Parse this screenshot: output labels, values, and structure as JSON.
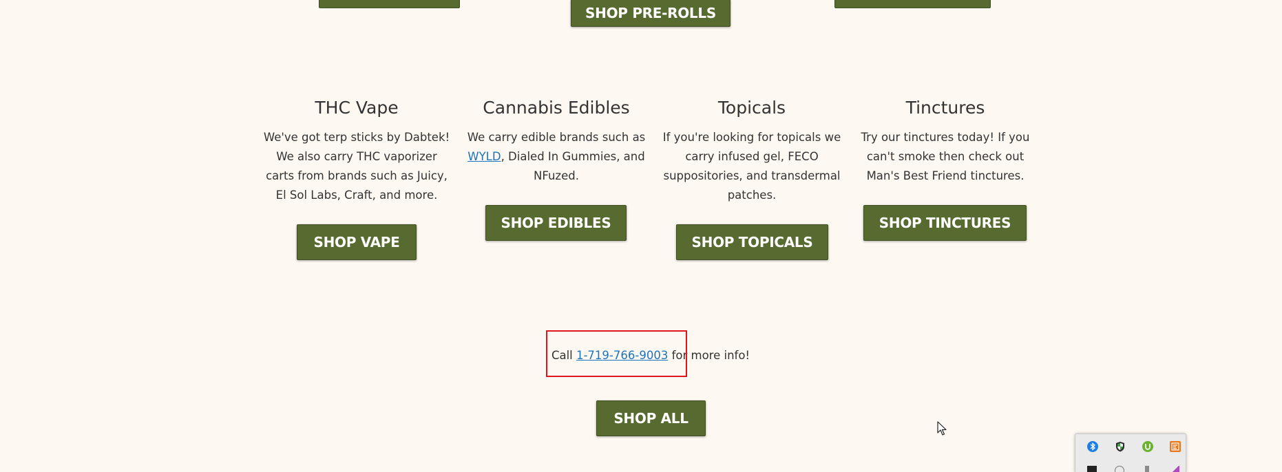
{
  "top_buttons": {
    "preroll_label": "SHOP PRE-ROLLS"
  },
  "categories": [
    {
      "title": "THC Vape",
      "text": "We've got terp sticks by Dabtek! We also carry THC vaporizer carts from brands such as Juicy, El Sol Labs, Craft, and more.",
      "button": "SHOP VAPE"
    },
    {
      "title": "Cannabis Edibles",
      "text_before": "We carry edible brands such as ",
      "link": "WYLD",
      "text_after": ", Dialed In Gummies, and NFuzed.",
      "button": "SHOP EDIBLES"
    },
    {
      "title": "Topicals",
      "text": "If you're looking for topicals we carry infused gel, FECO suppositories, and transdermal patches.",
      "button": "SHOP TOPICALS"
    },
    {
      "title": "Tinctures",
      "text": "Try our tinctures today! If you can't smoke then check out Man's Best Friend tinctures.",
      "button": "SHOP TINCTURES"
    }
  ],
  "call": {
    "prefix": "Call ",
    "phone": "1-719-766-9003",
    "suffix": " for more info!"
  },
  "shop_all": {
    "label": "SHOP ALL"
  },
  "tray": {
    "icons": [
      "bluetooth-icon",
      "security-shield-icon",
      "utorrent-icon",
      "app-orange-icon"
    ]
  },
  "colors": {
    "page_background": "#fdf8f2",
    "button_green": "#576b30",
    "link_blue": "#1e73be",
    "highlight_red": "#e0161c"
  }
}
